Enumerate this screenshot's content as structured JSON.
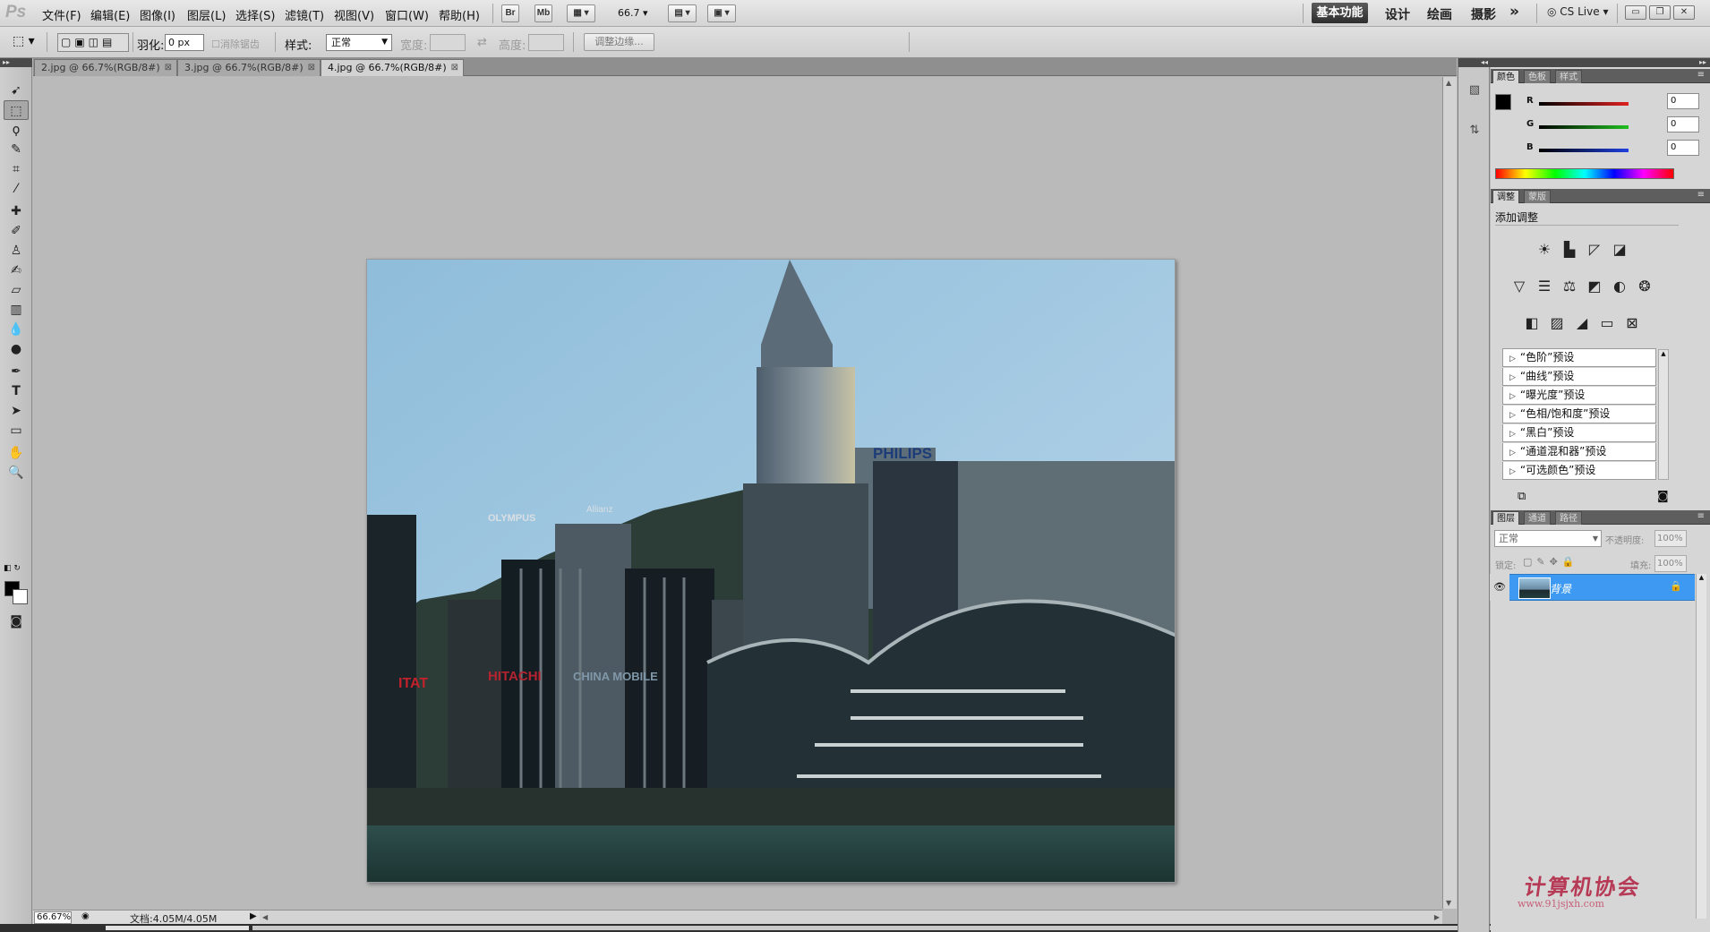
{
  "app": {
    "logo": "Ps"
  },
  "menubar": {
    "items": [
      "文件(F)",
      "编辑(E)",
      "图像(I)",
      "图层(L)",
      "选择(S)",
      "滤镜(T)",
      "视图(V)",
      "窗口(W)",
      "帮助(H)"
    ],
    "bridge_label": "Br",
    "minibridge_label": "Mb",
    "zoom": "66.7",
    "workspaces": [
      "基本功能",
      "设计",
      "绘画",
      "摄影"
    ],
    "more_label": "»",
    "cs_live": "CS Live",
    "colors": {
      "accent": "#3d99f2"
    }
  },
  "options": {
    "feather_label": "羽化:",
    "feather_value": "0 px",
    "antialias_label": "消除锯齿",
    "style_label": "样式:",
    "style_value": "正常",
    "width_label": "宽度:",
    "height_label": "高度:",
    "refine_edge": "调整边缘..."
  },
  "tabs": [
    {
      "label": "2.jpg @ 66.7%(RGB/8#)",
      "active": false
    },
    {
      "label": "3.jpg @ 66.7%(RGB/8#)",
      "active": false
    },
    {
      "label": "4.jpg @ 66.7%(RGB/8#)",
      "active": true
    }
  ],
  "photo_signs": {
    "philips": "PHILIPS",
    "olympus": "OLYMPUS",
    "allianz": "Allianz",
    "hitachi": "HITACHI",
    "china_mobile": "CHINA MOBILE",
    "itat": "ITAT"
  },
  "status": {
    "zoom": "66.67%",
    "doc_info": "文档:4.05M/4.05M"
  },
  "color_panel": {
    "tabs": [
      "颜色",
      "色板",
      "样式"
    ],
    "channels": [
      {
        "label": "R",
        "value": "0",
        "color": "#e02020"
      },
      {
        "label": "G",
        "value": "0",
        "color": "#20c020"
      },
      {
        "label": "B",
        "value": "0",
        "color": "#2040e0"
      }
    ]
  },
  "adjustments_panel": {
    "tabs": [
      "调整",
      "蒙版"
    ],
    "title": "添加调整",
    "presets": [
      "“色阶”预设",
      "“曲线”预设",
      "“曝光度”预设",
      "“色相/饱和度”预设",
      "“黑白”预设",
      "“通道混和器”预设",
      "“可选颜色”预设"
    ]
  },
  "layers_panel": {
    "tabs": [
      "图层",
      "通道",
      "路径"
    ],
    "blend_mode": "正常",
    "opacity_label": "不透明度:",
    "opacity_value": "100%",
    "lock_label": "锁定:",
    "fill_label": "填充:",
    "fill_value": "100%",
    "layer_name": "背景"
  },
  "watermark": {
    "text": "计算机协会",
    "url": "www.91jsjxh.com"
  }
}
